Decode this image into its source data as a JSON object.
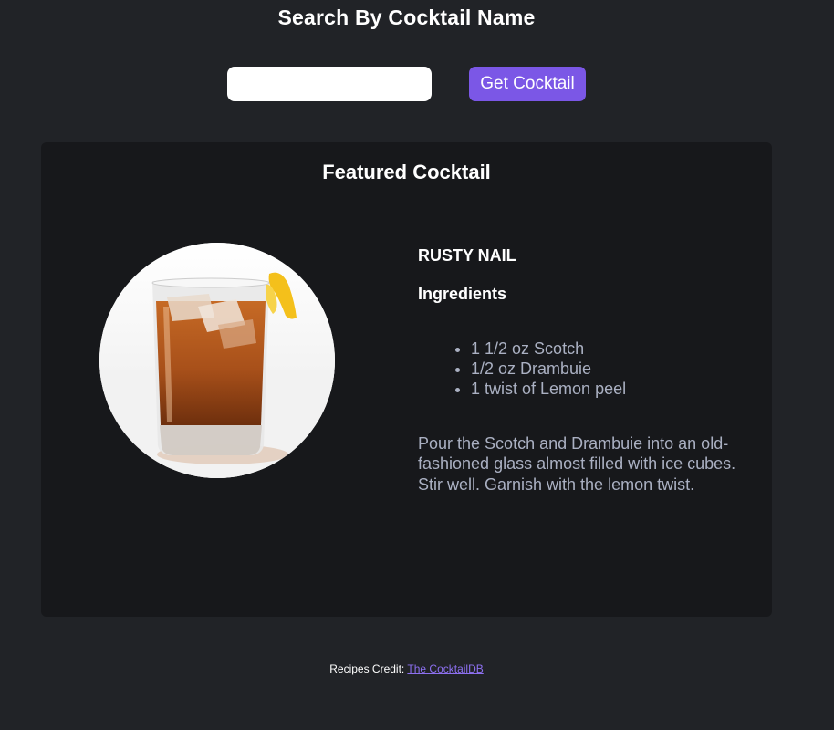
{
  "header": {
    "title": "Search By Cocktail Name"
  },
  "search": {
    "value": "",
    "placeholder": "",
    "button_label": "Get Cocktail"
  },
  "featured": {
    "heading": "Featured Cocktail",
    "name": "RUSTY NAIL",
    "ingredients_heading": "Ingredients",
    "ingredients": [
      "1 1/2 oz Scotch",
      "1/2 oz Drambuie",
      "1 twist of Lemon peel"
    ],
    "instructions": "Pour the Scotch and Drambuie into an old-fashioned glass almost filled with ice cubes. Stir well. Garnish with the lemon twist."
  },
  "footer": {
    "credit_label": "Recipes Credit:",
    "link_text": "The CocktailDB"
  },
  "colors": {
    "background": "#212327",
    "card": "#17181b",
    "accent": "#7b57e6",
    "link": "#8d70f0",
    "muted_text": "#aab0c2"
  }
}
